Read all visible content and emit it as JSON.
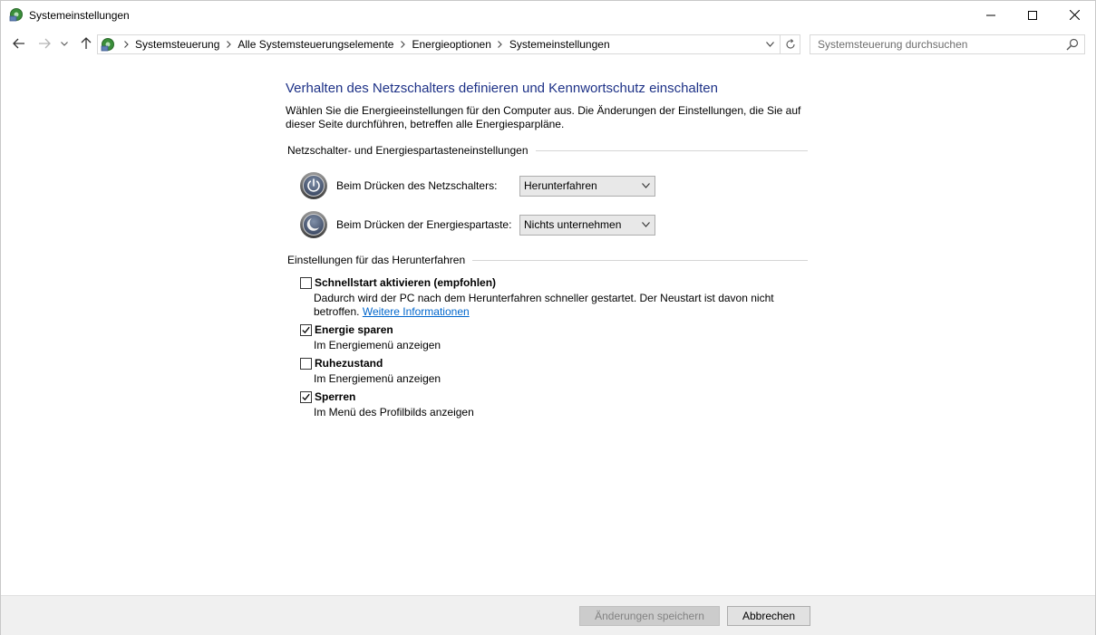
{
  "window": {
    "title": "Systemeinstellungen"
  },
  "address_bar": {
    "breadcrumbs": [
      "Systemsteuerung",
      "Alle Systemsteuerungselemente",
      "Energieoptionen",
      "Systemeinstellungen"
    ]
  },
  "search": {
    "placeholder": "Systemsteuerung durchsuchen"
  },
  "main": {
    "title": "Verhalten des Netzschalters definieren und Kennwortschutz einschalten",
    "description": "Wählen Sie die Energieeinstellungen für den Computer aus. Die Änderungen der Einstellungen, die Sie auf dieser Seite durchführen, betreffen alle Energiesparpläne.",
    "power_group": {
      "header": "Netzschalter- und Energiespartasteneinstellungen",
      "power_button": {
        "label": "Beim Drücken des Netzschalters:",
        "value": "Herunterfahren"
      },
      "sleep_button": {
        "label": "Beim Drücken der Energiespartaste:",
        "value": "Nichts unternehmen"
      }
    },
    "shutdown_group": {
      "header": "Einstellungen für das Herunterfahren",
      "fast_startup": {
        "label": "Schnellstart aktivieren (empfohlen)",
        "checked": false,
        "desc_line1": "Dadurch wird der PC nach dem Herunterfahren schneller gestartet. Der Neustart ist davon nicht",
        "desc_line2": "betroffen.",
        "link": "Weitere Informationen"
      },
      "sleep": {
        "label": "Energie sparen",
        "checked": true,
        "desc": "Im Energiemenü anzeigen"
      },
      "hibernate": {
        "label": "Ruhezustand",
        "checked": false,
        "desc": "Im Energiemenü anzeigen"
      },
      "lock": {
        "label": "Sperren",
        "checked": true,
        "desc": "Im Menü des Profilbilds anzeigen"
      }
    }
  },
  "footer": {
    "save_label": "Änderungen speichern",
    "cancel_label": "Abbrechen"
  },
  "colors": {
    "title_blue": "#1e3287",
    "link_blue": "#0066cc"
  }
}
